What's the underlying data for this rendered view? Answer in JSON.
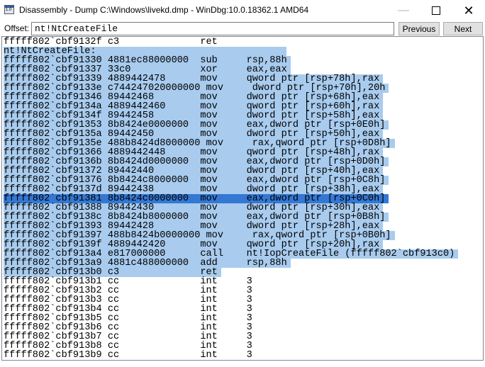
{
  "window": {
    "title": "Disassembly - Dump C:\\Windows\\livekd.dmp - WinDbg:10.0.18362.1 AMD64",
    "minimize": "—",
    "close": "✕"
  },
  "toolbar": {
    "offset_label": "Offset:",
    "offset_value": "nt!NtCreateFile",
    "previous_label": "Previous",
    "next_label": "Next"
  },
  "colors": {
    "selection": "#a8cbee",
    "current_line": "#3478d4"
  },
  "lines": [
    {
      "text": "fffff802`cbf9132f c3              ret",
      "state": "none"
    },
    {
      "text": "nt!NtCreateFile:",
      "state": "sel"
    },
    {
      "text": "fffff802`cbf91330 4881ec88000000  sub     rsp,88h",
      "state": "sel"
    },
    {
      "text": "fffff802`cbf91337 33c0            xor     eax,eax",
      "state": "sel"
    },
    {
      "text": "fffff802`cbf91339 4889442478      mov     qword ptr [rsp+78h],rax",
      "state": "sel"
    },
    {
      "text": "fffff802`cbf9133e c744247020000000 mov     dword ptr [rsp+70h],20h",
      "state": "sel"
    },
    {
      "text": "fffff802`cbf91346 89442468        mov     dword ptr [rsp+68h],eax",
      "state": "sel"
    },
    {
      "text": "fffff802`cbf9134a 4889442460      mov     qword ptr [rsp+60h],rax",
      "state": "sel"
    },
    {
      "text": "fffff802`cbf9134f 89442458        mov     dword ptr [rsp+58h],eax",
      "state": "sel"
    },
    {
      "text": "fffff802`cbf91353 8b8424e0000000  mov     eax,dword ptr [rsp+0E0h]",
      "state": "sel"
    },
    {
      "text": "fffff802`cbf9135a 89442450        mov     dword ptr [rsp+50h],eax",
      "state": "sel"
    },
    {
      "text": "fffff802`cbf9135e 488b8424d8000000 mov     rax,qword ptr [rsp+0D8h]",
      "state": "sel"
    },
    {
      "text": "fffff802`cbf91366 4889442448      mov     qword ptr [rsp+48h],rax",
      "state": "sel"
    },
    {
      "text": "fffff802`cbf9136b 8b8424d0000000  mov     eax,dword ptr [rsp+0D0h]",
      "state": "sel"
    },
    {
      "text": "fffff802`cbf91372 89442440        mov     dword ptr [rsp+40h],eax",
      "state": "sel"
    },
    {
      "text": "fffff802`cbf91376 8b8424c8000000  mov     eax,dword ptr [rsp+0C8h]",
      "state": "sel"
    },
    {
      "text": "fffff802`cbf9137d 89442438        mov     dword ptr [rsp+38h],eax",
      "state": "sel"
    },
    {
      "text": "fffff802`cbf91381 8b8424c0000000  mov     eax,dword ptr [rsp+0C0h]",
      "state": "cur"
    },
    {
      "text": "fffff802`cbf91388 89442430        mov     dword ptr [rsp+30h],eax",
      "state": "sel"
    },
    {
      "text": "fffff802`cbf9138c 8b8424b8000000  mov     eax,dword ptr [rsp+0B8h]",
      "state": "sel"
    },
    {
      "text": "fffff802`cbf91393 89442428        mov     dword ptr [rsp+28h],eax",
      "state": "sel"
    },
    {
      "text": "fffff802`cbf91397 488b8424b0000000 mov     rax,qword ptr [rsp+0B0h]",
      "state": "sel"
    },
    {
      "text": "fffff802`cbf9139f 4889442420      mov     qword ptr [rsp+20h],rax",
      "state": "sel"
    },
    {
      "text": "fffff802`cbf913a4 e817000000      call    nt!IopCreateFile (fffff802`cbf913c0)",
      "state": "sel"
    },
    {
      "text": "fffff802`cbf913a9 4881c488000000  add     rsp,88h",
      "state": "sel"
    },
    {
      "text": "fffff802`cbf913b0 c3              ret",
      "state": "sel"
    },
    {
      "text": "fffff802`cbf913b1 cc              int     3",
      "state": "none"
    },
    {
      "text": "fffff802`cbf913b2 cc              int     3",
      "state": "none"
    },
    {
      "text": "fffff802`cbf913b3 cc              int     3",
      "state": "none"
    },
    {
      "text": "fffff802`cbf913b4 cc              int     3",
      "state": "none"
    },
    {
      "text": "fffff802`cbf913b5 cc              int     3",
      "state": "none"
    },
    {
      "text": "fffff802`cbf913b6 cc              int     3",
      "state": "none"
    },
    {
      "text": "fffff802`cbf913b7 cc              int     3",
      "state": "none"
    },
    {
      "text": "fffff802`cbf913b8 cc              int     3",
      "state": "none"
    },
    {
      "text": "fffff802`cbf913b9 cc              int     3",
      "state": "none"
    }
  ]
}
